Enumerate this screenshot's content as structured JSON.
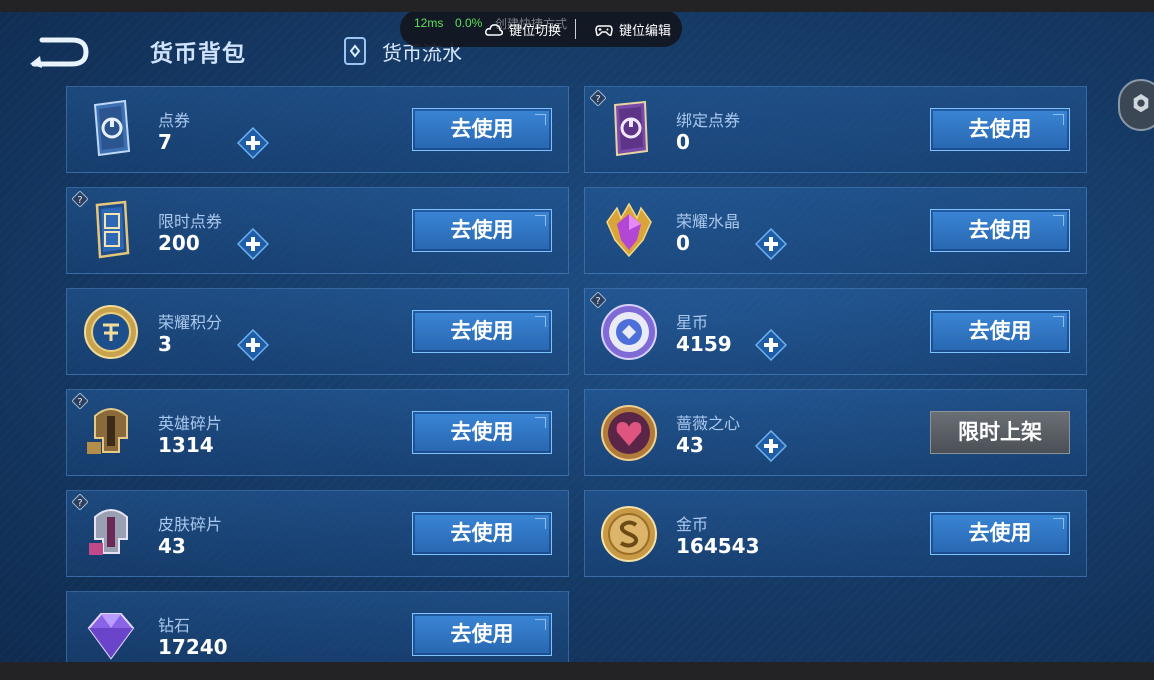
{
  "header": {
    "title": "货币背包",
    "flow_link": "货币流水"
  },
  "toolbar": {
    "latency": "12ms",
    "loss": "0.0%",
    "ghost_text": "创建快捷方式",
    "keymap_switch": "键位切换",
    "keymap_edit": "键位编辑"
  },
  "currencies": {
    "dianquan": {
      "name": "点券",
      "value": "7",
      "button": "去使用"
    },
    "bangding": {
      "name": "绑定点券",
      "value": "0",
      "button": "去使用"
    },
    "xianshi": {
      "name": "限时点券",
      "value": "200",
      "button": "去使用"
    },
    "shuijing": {
      "name": "荣耀水晶",
      "value": "0",
      "button": "去使用"
    },
    "jifen": {
      "name": "荣耀积分",
      "value": "3",
      "button": "去使用"
    },
    "xingbi": {
      "name": "星币",
      "value": "4159",
      "button": "去使用"
    },
    "yingxiong": {
      "name": "英雄碎片",
      "value": "1314",
      "button": "去使用"
    },
    "qiangwei": {
      "name": "蔷薇之心",
      "value": "43",
      "button": "限时上架"
    },
    "pifu": {
      "name": "皮肤碎片",
      "value": "43",
      "button": "去使用"
    },
    "jinbi": {
      "name": "金币",
      "value": "164543",
      "button": "去使用"
    },
    "zuanshi": {
      "name": "钻石",
      "value": "17240",
      "button": "去使用"
    }
  },
  "colors": {
    "button_blue": "#2e74c4",
    "button_disabled": "#565b62",
    "value_text": "#ffffff",
    "name_text": "#aac8ee",
    "plus_accent": "#2a6cb8"
  }
}
